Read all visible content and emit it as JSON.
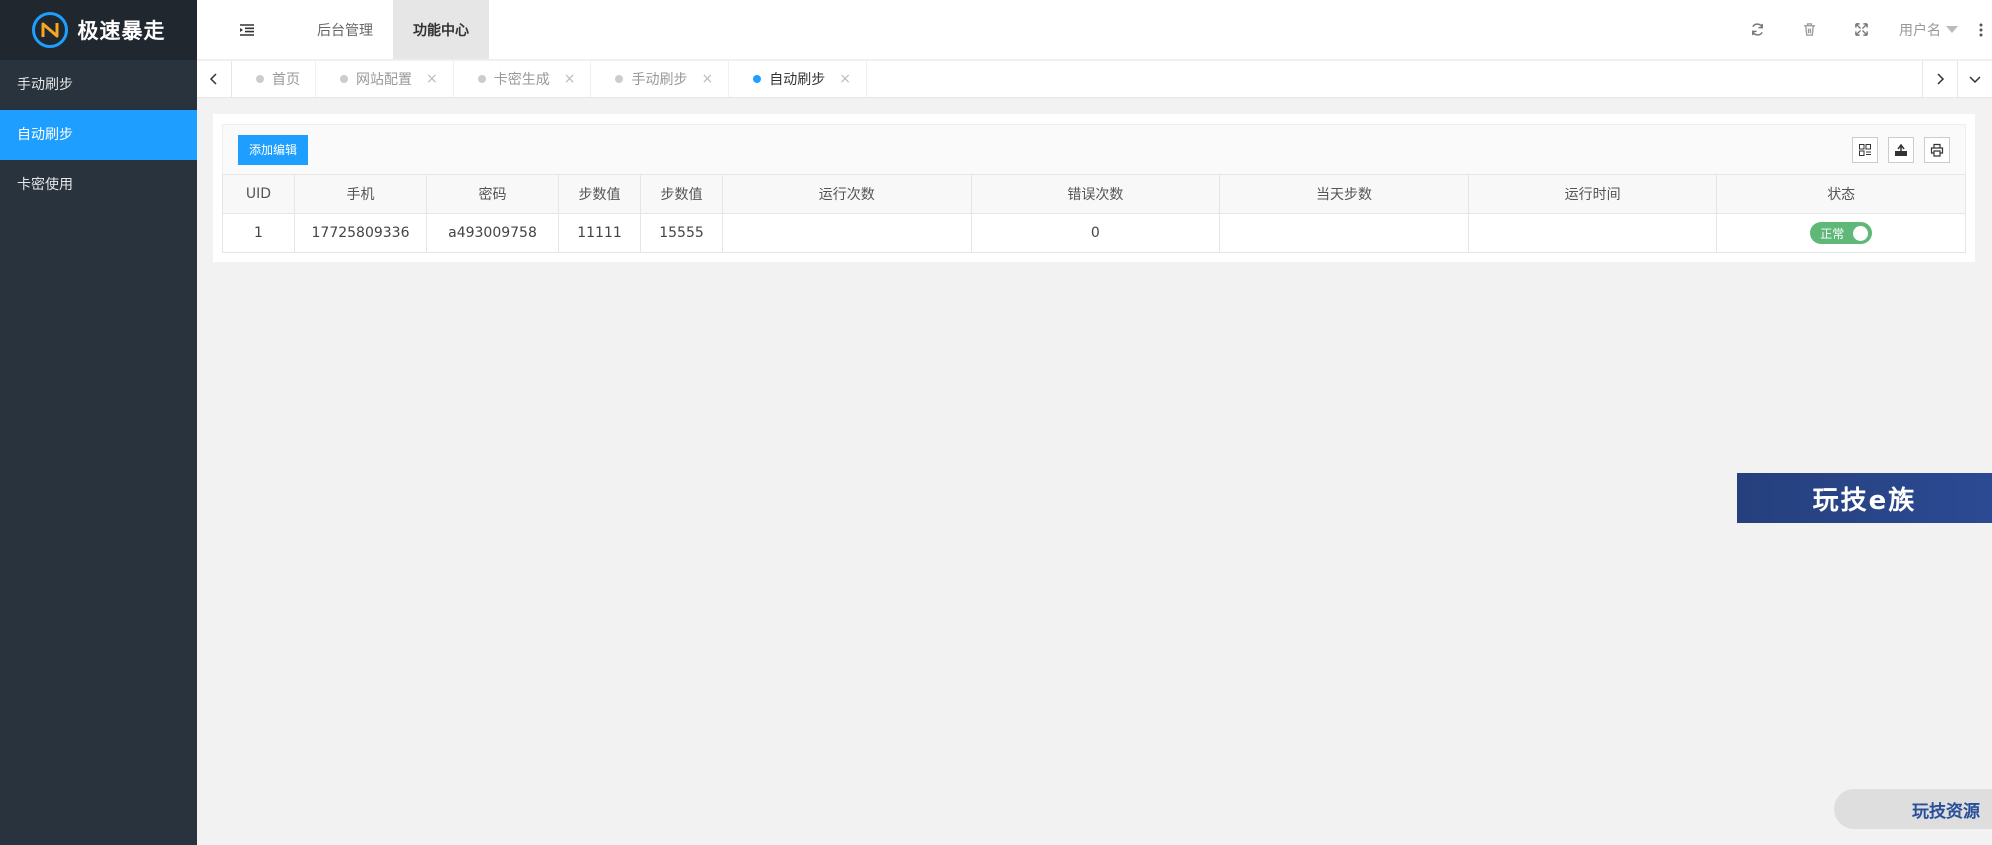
{
  "app": {
    "title": "极速暴走"
  },
  "sidebar": {
    "items": [
      {
        "label": "手动刷步",
        "active": false
      },
      {
        "label": "自动刷步",
        "active": true
      },
      {
        "label": "卡密使用",
        "active": false
      }
    ]
  },
  "header": {
    "tabs": [
      {
        "label": "后台管理",
        "active": false
      },
      {
        "label": "功能中心",
        "active": true
      }
    ],
    "username": "用户名",
    "icons": [
      "refresh-icon",
      "trash-icon",
      "fullscreen-icon",
      "more-vertical-icon"
    ]
  },
  "page_tabs": [
    {
      "label": "首页",
      "closable": false,
      "active": false
    },
    {
      "label": "网站配置",
      "closable": true,
      "active": false
    },
    {
      "label": "卡密生成",
      "closable": true,
      "active": false
    },
    {
      "label": "手动刷步",
      "closable": true,
      "active": false
    },
    {
      "label": "自动刷步",
      "closable": true,
      "active": true
    }
  ],
  "toolbar": {
    "add_label": "添加编辑",
    "icons": [
      "columns-icon",
      "export-icon",
      "print-icon"
    ]
  },
  "table": {
    "columns": [
      "UID",
      "手机",
      "密码",
      "步数值",
      "步数值",
      "运行次数",
      "错误次数",
      "当天步数",
      "运行时间",
      "状态"
    ],
    "rows": [
      [
        "1",
        "17725809336",
        "a493009758",
        "11111",
        "15555",
        "",
        "0",
        "",
        "",
        "正常"
      ]
    ]
  },
  "watermarks": {
    "banner": "玩技e族",
    "pill": "玩技资源"
  },
  "colors": {
    "sidebar_bg": "#28333e",
    "accent": "#1e9fff",
    "switch_on": "#5fb878"
  }
}
